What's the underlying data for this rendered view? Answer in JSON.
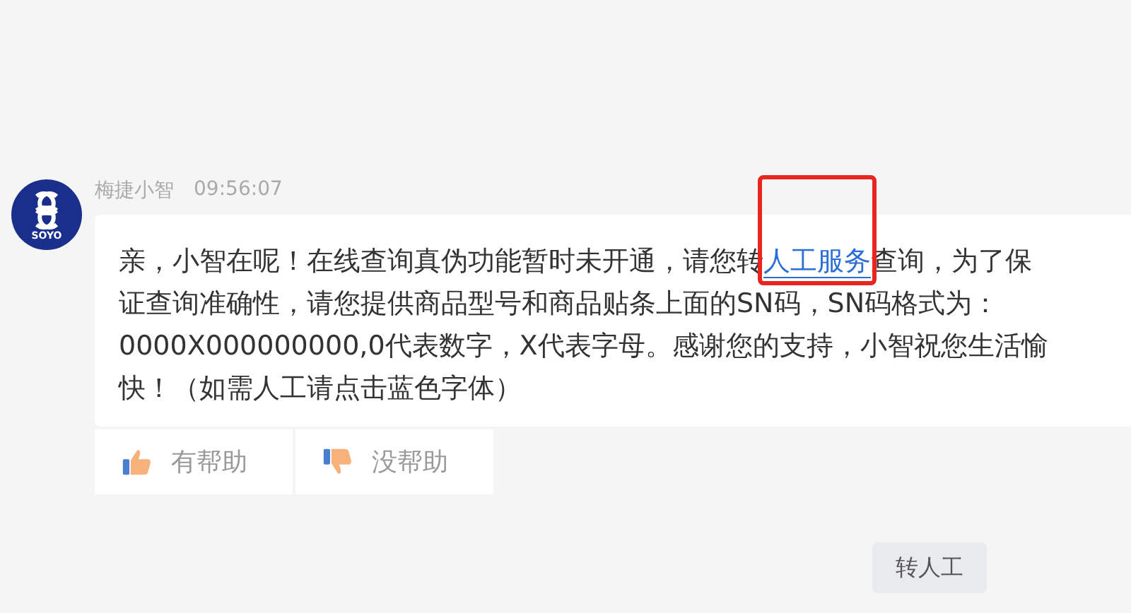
{
  "message": {
    "avatar_text": "SOYO",
    "sender": "梅捷小智",
    "time": "09:56:07",
    "text_before": "亲，小智在呢！在线查询真伪功能暂时未开通，请您转",
    "link": "人工服务",
    "text_after": "查询，为了保证查询准确性，请您提供商品型号和商品贴条上面的SN码，SN码格式为：0000X000000000,0代表数字，X代表字母。感谢您的支持，小智祝您生活愉快！（如需人工请点击蓝色字体）"
  },
  "feedback": [
    {
      "kind": "up",
      "label": "有帮助"
    },
    {
      "kind": "down",
      "label": "没帮助"
    }
  ],
  "quick_button": "转人工"
}
